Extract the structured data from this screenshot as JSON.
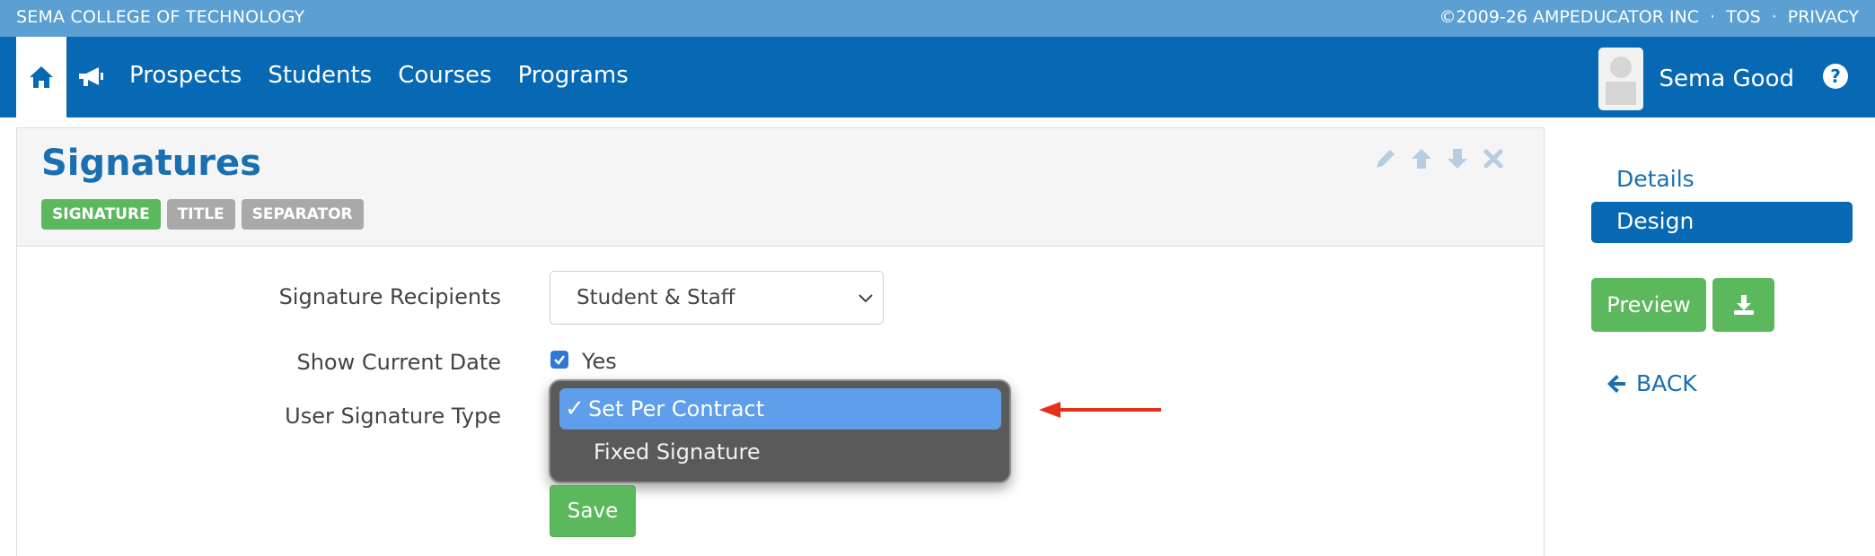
{
  "topbar": {
    "school": "SEMA COLLEGE OF TECHNOLOGY",
    "copyright": "©2009-26 AMPEDUCATOR INC",
    "tos": "TOS",
    "privacy": "PRIVACY",
    "separator": "·"
  },
  "nav": {
    "links": [
      "Prospects",
      "Students",
      "Courses",
      "Programs"
    ],
    "user_name": "Sema Good",
    "help_label": "?"
  },
  "panel": {
    "title": "Signatures",
    "badges": [
      "SIGNATURE",
      "TITLE",
      "SEPARATOR"
    ]
  },
  "form": {
    "recipients_label": "Signature Recipients",
    "recipients_value": "Student & Staff",
    "show_date_label": "Show Current Date",
    "show_date_checked_label": "Yes",
    "user_sig_label": "User Signature Type",
    "user_sig_options": [
      "Set Per Contract",
      "Fixed Signature"
    ],
    "user_sig_selected": "Set Per Contract",
    "save_label": "Save"
  },
  "sidebar": {
    "details": "Details",
    "design": "Design",
    "preview": "Preview",
    "back": "BACK"
  },
  "colors": {
    "topbar": "#5b9fd3",
    "nav": "#0769b4",
    "accent_green": "#5cb85c",
    "badge_gray": "#a9a9a9",
    "title_blue": "#1a6fb0",
    "annotation_arrow": "#e2321e"
  },
  "icons": [
    "home-icon",
    "megaphone-icon",
    "help-icon",
    "pencil-icon",
    "arrow-up-icon",
    "arrow-down-icon",
    "close-icon",
    "chevron-down-icon",
    "check-icon",
    "download-icon",
    "back-arrow-icon"
  ]
}
